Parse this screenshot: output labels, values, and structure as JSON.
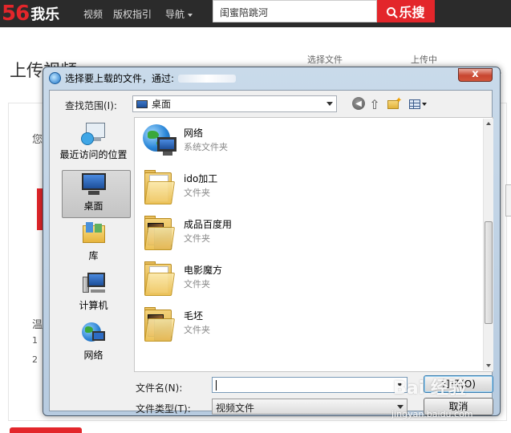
{
  "site": {
    "logo_number": "56",
    "logo_text": "我乐",
    "nav": [
      "视频",
      "版权指引",
      "导航"
    ],
    "search_value": "闺蜜陪跳河",
    "search_button": "乐搜",
    "page_title": "上传视频",
    "step1": "选择文件",
    "step2": "上传中",
    "side_chars": [
      "您",
      "温",
      "1",
      "2"
    ],
    "brand_color": "#e3262b"
  },
  "dialog": {
    "title": "选择要上载的文件，通过:",
    "close_label": "x",
    "lookin_label": "查找范围(I):",
    "lookin_value": "桌面",
    "places": [
      {
        "label": "最近访问的位置",
        "icon": "recent-places-icon"
      },
      {
        "label": "桌面",
        "icon": "desktop-icon"
      },
      {
        "label": "库",
        "icon": "libraries-icon"
      },
      {
        "label": "计算机",
        "icon": "computer-icon"
      },
      {
        "label": "网络",
        "icon": "network-icon"
      }
    ],
    "files": [
      {
        "name": "网络",
        "type": "系统文件夹",
        "icon": "network-icon"
      },
      {
        "name": "ido加工",
        "type": "文件夹",
        "icon": "folder-icon"
      },
      {
        "name": "成品百度用",
        "type": "文件夹",
        "icon": "folder-icon"
      },
      {
        "name": "电影魔方",
        "type": "文件夹",
        "icon": "folder-icon"
      },
      {
        "name": "毛坯",
        "type": "文件夹",
        "icon": "folder-icon"
      }
    ],
    "filename_label": "文件名(N):",
    "filename_value": "",
    "filetype_label": "文件类型(T):",
    "filetype_value": "视频文件",
    "open_button": "打开(O)",
    "cancel_button": "取消"
  },
  "watermark": {
    "text": "Bai 经验",
    "url": "jingyan.baidu.com"
  }
}
